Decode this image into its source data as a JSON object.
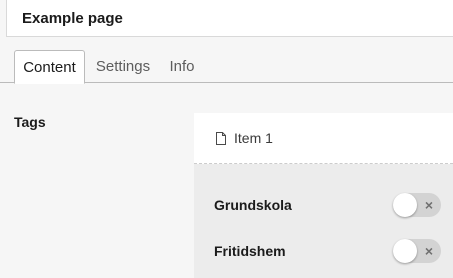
{
  "header": {
    "title_value": "Example page"
  },
  "tabs": [
    {
      "label": "Content",
      "active": true
    },
    {
      "label": "Settings",
      "active": false
    },
    {
      "label": "Info",
      "active": false
    }
  ],
  "tags": {
    "label": "Tags",
    "item": {
      "label": "Item 1",
      "icon": "document-icon"
    },
    "options": [
      {
        "label": "Grundskola",
        "enabled": false,
        "toggle_icon": "x-icon"
      },
      {
        "label": "Fritidshem",
        "enabled": false,
        "toggle_icon": "x-icon"
      }
    ],
    "toggle_glyph": "×"
  },
  "colors": {
    "background": "#f6f6f6",
    "panel": "#ececec",
    "toggle_off": "#d3d3d3"
  }
}
